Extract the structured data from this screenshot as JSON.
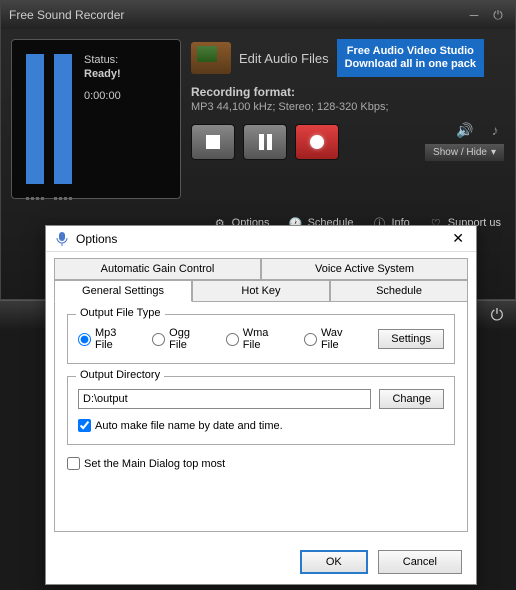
{
  "app": {
    "title": "Free Sound Recorder"
  },
  "status": {
    "label": "Status:",
    "value": "Ready!",
    "timer": "0:00:00"
  },
  "edit_audio": "Edit Audio Files",
  "promo": {
    "line1": "Free Audio Video Studio",
    "line2": "Download all in one pack"
  },
  "format": {
    "label": "Recording format:",
    "detail": "MP3 44,100 kHz; Stereo;  128-320 Kbps;"
  },
  "show_hide": "Show / Hide",
  "bottom": {
    "options": "Options",
    "schedule": "Schedule",
    "info": "Info",
    "support": "Support us"
  },
  "dialog": {
    "title": "Options",
    "tabs_row1": [
      "Automatic Gain Control",
      "Voice Active System"
    ],
    "tabs_row2": [
      "General Settings",
      "Hot Key",
      "Schedule"
    ],
    "active_tab": "General Settings",
    "output_type": {
      "legend": "Output File Type",
      "options": [
        "Mp3 File",
        "Ogg File",
        "Wma File",
        "Wav File"
      ],
      "selected": "Mp3 File",
      "settings_btn": "Settings"
    },
    "output_dir": {
      "legend": "Output Directory",
      "value": "D:\\output",
      "change_btn": "Change",
      "auto_name": "Auto make file name by date and time.",
      "auto_name_checked": true
    },
    "top_most": "Set the Main Dialog top most",
    "top_most_checked": false,
    "ok": "OK",
    "cancel": "Cancel"
  }
}
